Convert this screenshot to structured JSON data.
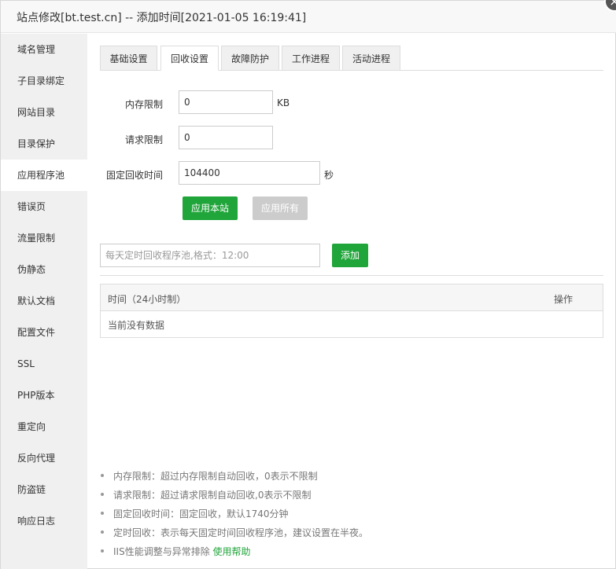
{
  "title": "站点修改[bt.test.cn] -- 添加时间[2021-01-05 16:19:41]",
  "close_icon": "close-icon",
  "sidebar": {
    "items": [
      {
        "label": "域名管理"
      },
      {
        "label": "子目录绑定"
      },
      {
        "label": "网站目录"
      },
      {
        "label": "目录保护"
      },
      {
        "label": "应用程序池"
      },
      {
        "label": "错误页"
      },
      {
        "label": "流量限制"
      },
      {
        "label": "伪静态"
      },
      {
        "label": "默认文档"
      },
      {
        "label": "配置文件"
      },
      {
        "label": "SSL"
      },
      {
        "label": "PHP版本"
      },
      {
        "label": "重定向"
      },
      {
        "label": "反向代理"
      },
      {
        "label": "防盗链"
      },
      {
        "label": "响应日志"
      }
    ],
    "active_index": 4
  },
  "tabs": [
    {
      "label": "基础设置"
    },
    {
      "label": "回收设置"
    },
    {
      "label": "故障防护"
    },
    {
      "label": "工作进程"
    },
    {
      "label": "活动进程"
    }
  ],
  "form": {
    "memory_label": "内存限制",
    "memory_value": "0",
    "memory_unit": "KB",
    "request_label": "请求限制",
    "request_value": "0",
    "fixed_label": "固定回收时间",
    "fixed_value": "104400",
    "fixed_unit": "秒",
    "apply_site_label": "应用本站",
    "apply_all_label": "应用所有"
  },
  "schedule": {
    "placeholder": "每天定时回收程序池,格式：12:00",
    "add_label": "添加"
  },
  "table": {
    "col_time": "时间（24小时制）",
    "col_op": "操作",
    "empty_text": "当前没有数据"
  },
  "help": {
    "items": [
      "内存限制：超过内存限制自动回收，0表示不限制",
      "请求限制：超过请求限制自动回收,0表示不限制",
      "固定回收时间：固定回收，默认1740分钟",
      "定时回收：表示每天固定时间回收程序池，建议设置在半夜。"
    ],
    "last_text": "IIS性能调整与异常排除",
    "last_link": "使用帮助"
  },
  "colors": {
    "accent": "#20a53a",
    "disabled": "#cccccc"
  }
}
